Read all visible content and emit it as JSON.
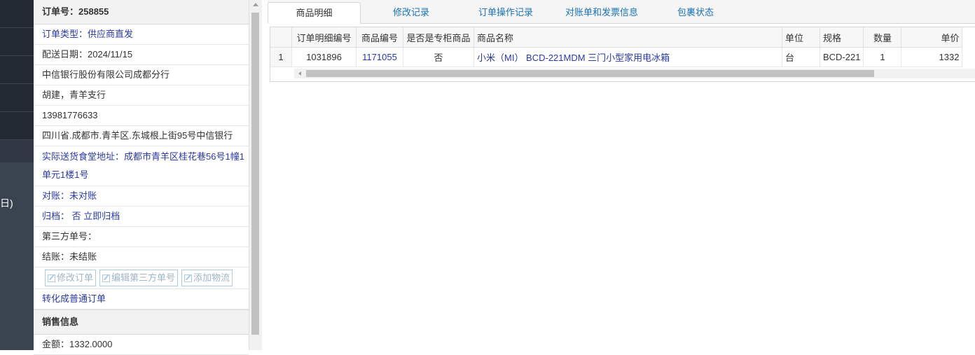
{
  "nav": {
    "partial_label": "日)"
  },
  "order": {
    "number_label": "订单号：258855",
    "type": "订单类型：供应商直发",
    "delivery_date": "配送日期：2024/11/15",
    "company": "中信银行股份有限公司成都分行",
    "contact": "胡建，青羊支行",
    "phone": "13981776633",
    "address": "四川省.成都市.青羊区.东城根上街95号中信银行",
    "actual_address": "实际送货食堂地址：成都市青羊区桂花巷56号1幢1单元1楼1号",
    "reconcile": "对账：未对账",
    "archive_prefix": "归档：  否",
    "archive_link": "立即归档",
    "third_party": "第三方单号：",
    "settlement": "结账：未结账",
    "buttons": {
      "modify": "修改订单",
      "edit_third": "编辑第三方单号",
      "add_logistics": "添加物流"
    },
    "convert_link": "转化成普通订单"
  },
  "sales": {
    "section_title": "销售信息",
    "amount": "金额：1332.0000"
  },
  "tabs": [
    {
      "label": "商品明细"
    },
    {
      "label": "修改记录"
    },
    {
      "label": "订单操作记录"
    },
    {
      "label": "对账单和发票信息"
    },
    {
      "label": "包裹状态"
    }
  ],
  "grid": {
    "headers": [
      "订单明细编号",
      "商品编号",
      "是否是专柜商品",
      "商品名称",
      "单位",
      "规格",
      "数量",
      "单价"
    ],
    "rows": [
      {
        "row_number": "1",
        "detail_id": "1031896",
        "product_id": "1171055",
        "is_counter": "否",
        "name": "小米（MI） BCD-221MDM 三门小型家用电冰箱",
        "unit": "台",
        "spec": "BCD-221",
        "qty": "1",
        "price": "1332"
      }
    ]
  }
}
